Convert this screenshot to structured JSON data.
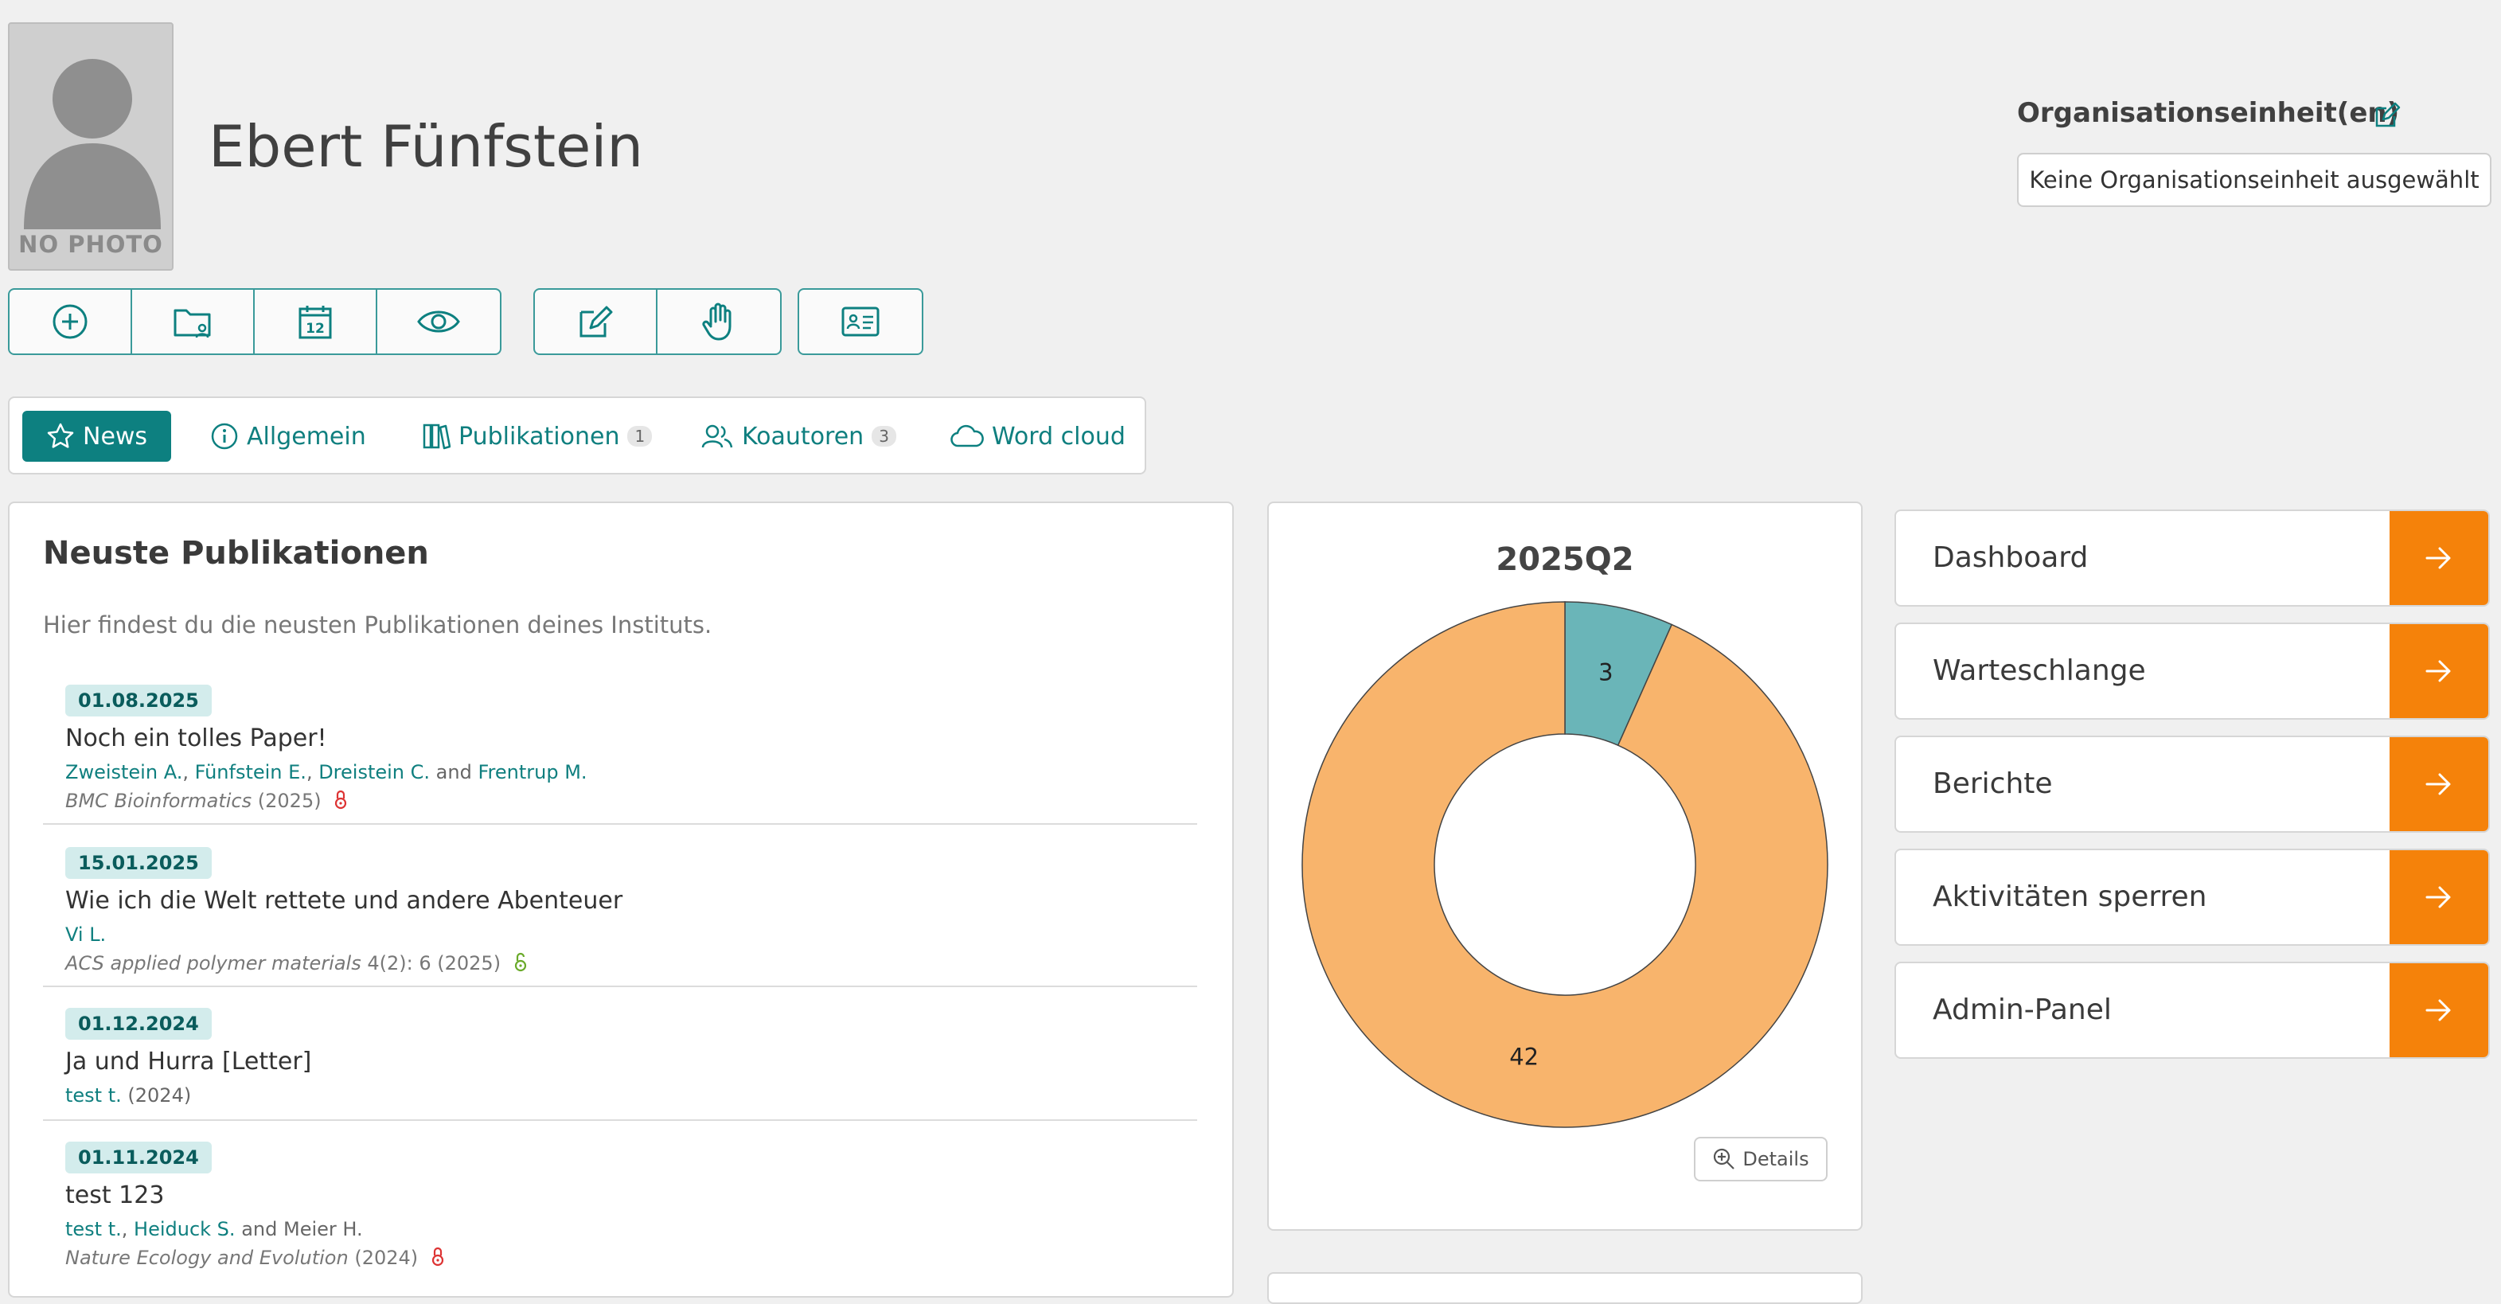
{
  "profile": {
    "name": "Ebert Fünfstein",
    "photo_placeholder": "NO PHOTO"
  },
  "org_units": {
    "label": "Organisationseinheit(en)",
    "value": "Keine Organisationseinheit ausgewählt"
  },
  "toolbar": {
    "group1": [
      "plus-circle-icon",
      "folder-user-icon",
      "calendar-icon",
      "eye-icon"
    ],
    "group2": [
      "edit-icon",
      "hand-icon"
    ],
    "group3": [
      "id-card-icon"
    ]
  },
  "tabs": [
    {
      "label": "News",
      "icon": "star-icon",
      "active": true
    },
    {
      "label": "Allgemein",
      "icon": "info-icon"
    },
    {
      "label": "Publikationen",
      "icon": "books-icon",
      "badge": "1"
    },
    {
      "label": "Koautoren",
      "icon": "users-icon",
      "badge": "3"
    },
    {
      "label": "Word cloud",
      "icon": "cloud-icon"
    }
  ],
  "publications_card": {
    "title": "Neuste Publikationen",
    "subtitle": "Hier findest du die neusten Publikationen deines Instituts.",
    "items": [
      {
        "date": "01.08.2025",
        "title": "Noch ein tolles Paper!",
        "authors": [
          "Zweistein A.",
          "Fünfstein E.",
          "Dreistein C."
        ],
        "and_word": "and",
        "last_author": "Frentrup M.",
        "journal": "BMC Bioinformatics",
        "details": "(2025)",
        "access": "closed"
      },
      {
        "date": "15.01.2025",
        "title": "Wie ich die Welt rettete und andere Abenteuer",
        "authors": [
          "Vi L."
        ],
        "journal": "ACS applied polymer materials",
        "details": "4(2): 6 (2025)",
        "access": "open"
      },
      {
        "date": "01.12.2024",
        "title": "Ja und Hurra [Letter]",
        "authors": [
          "test t."
        ],
        "authors_suffix": "(2024)"
      },
      {
        "date": "01.11.2024",
        "title": "test 123",
        "authors": [
          "test t.",
          "Heiduck S."
        ],
        "and_word": "and",
        "last_author_plain": "Meier H.",
        "journal": "Nature Ecology and Evolution",
        "details": "(2024)",
        "access": "closed"
      }
    ]
  },
  "chart_data": {
    "type": "pie",
    "title": "2025Q2",
    "categories": [
      "",
      ""
    ],
    "values": [
      3,
      42
    ],
    "colors": [
      "#6ab5b8",
      "#f8b46c"
    ],
    "donut": true
  },
  "chart_card": {
    "details_label": "Details"
  },
  "nav": [
    {
      "label": "Dashboard"
    },
    {
      "label": "Warteschlange"
    },
    {
      "label": "Berichte"
    },
    {
      "label": "Aktivitäten sperren"
    },
    {
      "label": "Admin-Panel"
    }
  ],
  "colors": {
    "teal": "#0d8080",
    "orange": "#f5820a",
    "background": "#f0f0f0"
  }
}
